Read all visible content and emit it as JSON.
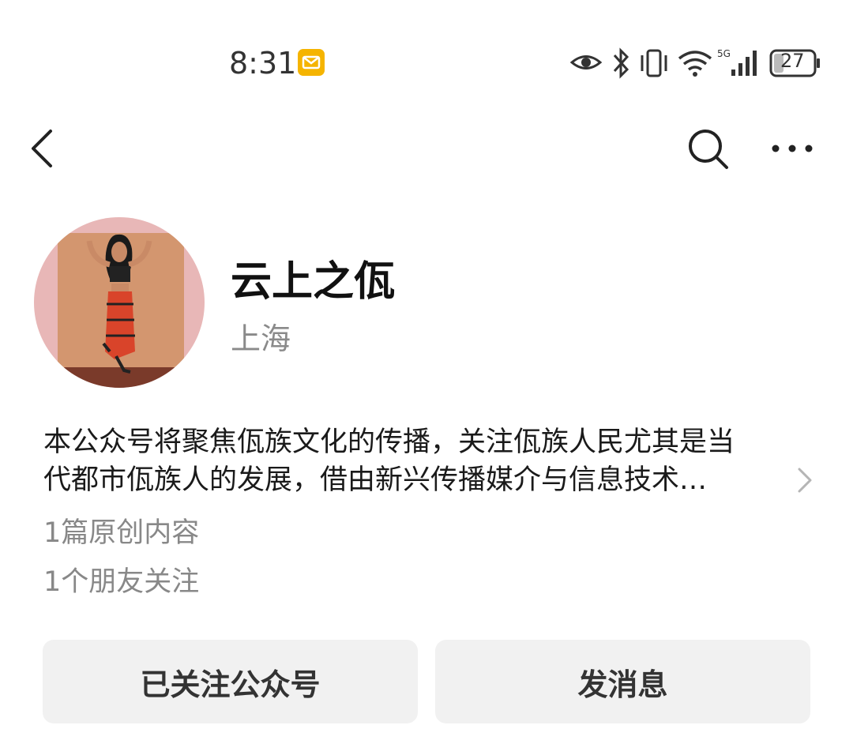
{
  "status_bar": {
    "time": "8:31",
    "battery": "27",
    "network": "5G",
    "icons": [
      "mail-icon",
      "eye-icon",
      "bluetooth-icon",
      "vibrate-icon",
      "wifi-icon",
      "signal-icon",
      "battery-icon"
    ]
  },
  "nav": {
    "icons": [
      "back-icon",
      "search-icon",
      "more-icon"
    ]
  },
  "profile": {
    "name": "云上之佤",
    "region": "上海",
    "description_line1": "本公众号将聚焦佤族文化的传播，关注佤族人民尤其是当",
    "description_line2": "代都市佤族人的发展，借由新兴传播媒介与信息技术…",
    "original_count": "1篇原创内容",
    "friends_following": "1个朋友关注"
  },
  "actions": {
    "follow_label": "已关注公众号",
    "message_label": "发消息"
  },
  "colors": {
    "accent_mail": "#F5B400",
    "button_bg": "#F1F1F1",
    "secondary_text": "#8A8A8A"
  }
}
